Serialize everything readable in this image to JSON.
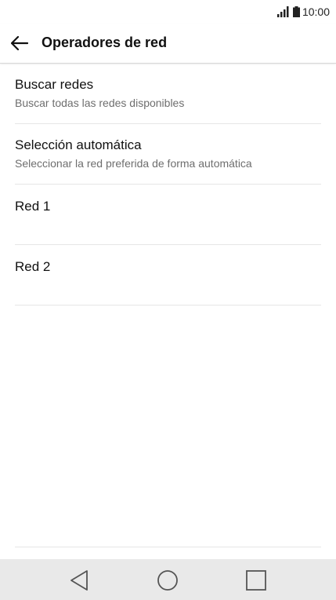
{
  "status_bar": {
    "time": "10:00",
    "signal_icon": "signal-bars-icon",
    "battery_icon": "battery-icon"
  },
  "header": {
    "back_icon": "arrow-left-icon",
    "title": "Operadores de red"
  },
  "list": {
    "items": [
      {
        "title": "Buscar redes",
        "subtitle": "Buscar todas las redes disponibles"
      },
      {
        "title": "Selección automática",
        "subtitle": "Seleccionar la red preferida de forma automática"
      },
      {
        "title": "Red 1"
      },
      {
        "title": "Red 2"
      }
    ]
  },
  "nav_bar": {
    "back_icon": "triangle-back-icon",
    "home_icon": "circle-home-icon",
    "recents_icon": "square-recents-icon"
  },
  "colors": {
    "background": "#ffffff",
    "nav_bar": "#e9e9e9",
    "text_primary": "#111111",
    "text_secondary": "#6e6e6e",
    "divider": "#e6e6e6"
  }
}
